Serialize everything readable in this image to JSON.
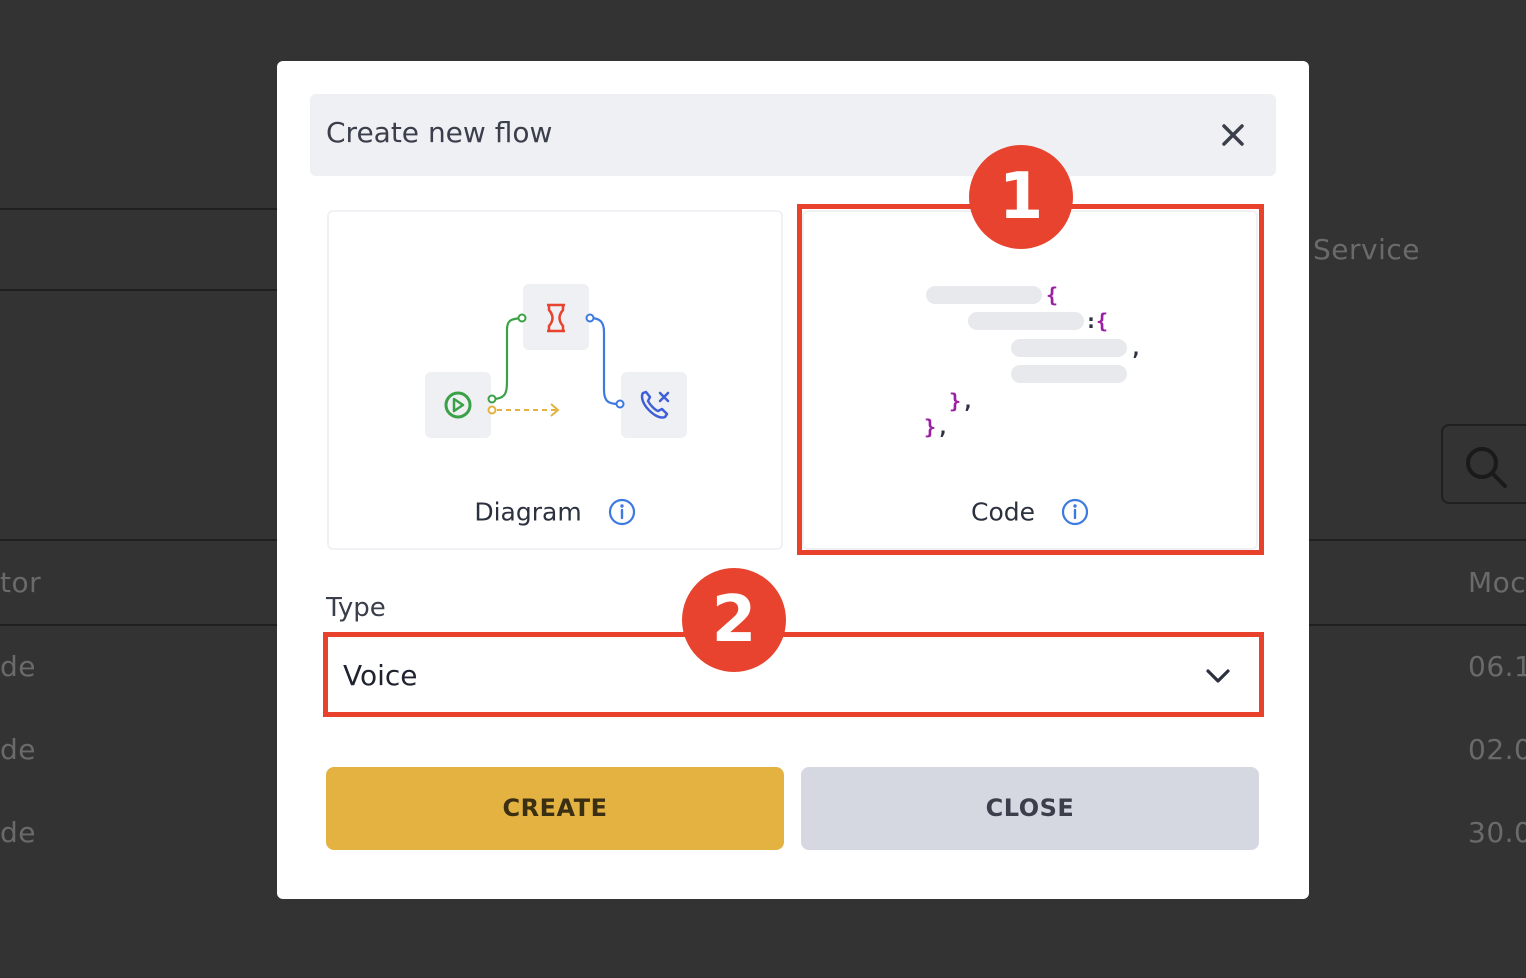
{
  "background": {
    "service_header": "Service",
    "creator_header_partial": "tor",
    "modified_header_partial": "Moc",
    "rows": [
      {
        "creator_partial": "de",
        "modified_partial": "06.1:"
      },
      {
        "creator_partial": "de",
        "modified_partial": "02.0"
      },
      {
        "creator_partial": "de",
        "modified_partial": "30.0"
      }
    ]
  },
  "modal": {
    "title": "Create new flow",
    "options": {
      "diagram_label": "Diagram",
      "code_label": "Code"
    },
    "type_field": {
      "label": "Type",
      "selected_value": "Voice"
    },
    "buttons": {
      "create": "CREATE",
      "close": "CLOSE"
    }
  },
  "annotations": {
    "step1": "1",
    "step2": "2"
  },
  "colors": {
    "highlight": "#e8412c",
    "create_button": "#e3b241",
    "close_button": "#d5d7e1",
    "info_icon": "#3d7ae0"
  },
  "icons": [
    "close-icon",
    "info-icon",
    "chevron-down-icon",
    "search-icon",
    "play-icon",
    "hourglass-icon",
    "phone-missed-icon"
  ]
}
